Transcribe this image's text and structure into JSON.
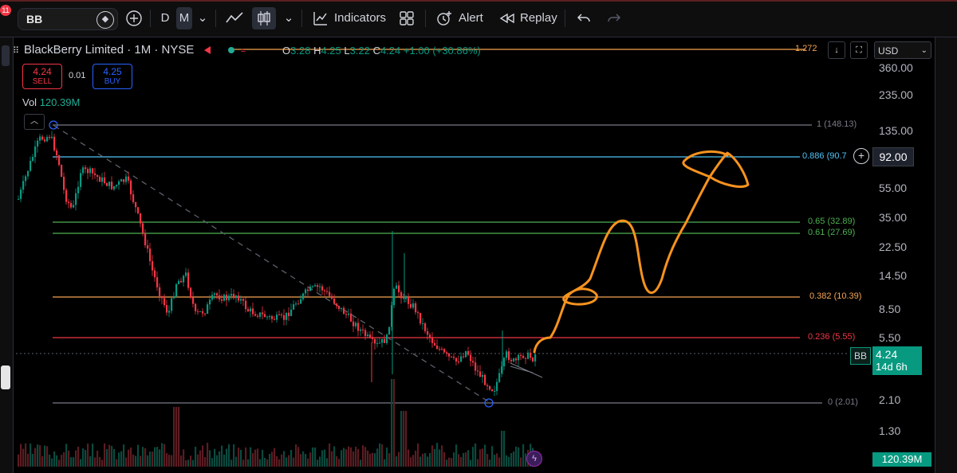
{
  "toolbar": {
    "notification_count": "11",
    "symbol": "BB",
    "interval_d": "D",
    "interval_m": "M",
    "indicators_label": "Indicators",
    "alert_label": "Alert",
    "replay_label": "Replay"
  },
  "legend": {
    "title": "BlackBerry Limited · 1M · NYSE",
    "open_label": "O",
    "open": "3.28",
    "high_label": "H",
    "high": "4.25",
    "low_label": "L",
    "low": "3.22",
    "close_label": "C",
    "close": "4.24",
    "change": "+1.00 (+30.86%)",
    "sell_price": "4.24",
    "sell_label": "SELL",
    "spread": "0.01",
    "buy_price": "4.25",
    "buy_label": "BUY",
    "volume_label": "Vol",
    "volume": "120.39M"
  },
  "price_axis": {
    "currency": "USD",
    "ticks": [
      "360.00",
      "235.00",
      "135.00",
      "55.00",
      "35.00",
      "22.50",
      "14.50",
      "8.50",
      "5.50",
      "2.10",
      "1.30"
    ],
    "crosshair_price": "92.00",
    "symbol_tag": "BB",
    "last_price": "4.24",
    "countdown": "14d 6h",
    "volume_tag": "120.39M"
  },
  "fib_levels": [
    {
      "label": "1.272",
      "color": "#f7a552"
    },
    {
      "label": "1 (148.13)",
      "color": "#787b86"
    },
    {
      "label": "0.886 (90.7",
      "color": "#4fc3f7"
    },
    {
      "label": "0.65 (32.89)",
      "color": "#4caf50"
    },
    {
      "label": "0.61 (27.69)",
      "color": "#4caf50"
    },
    {
      "label": "0.382 (10.39)",
      "color": "#f7a552"
    },
    {
      "label": "0.236 (5.55)",
      "color": "#f23645"
    },
    {
      "label": "0 (2.01)",
      "color": "#787b86"
    }
  ],
  "colors": {
    "up": "#089981",
    "down": "#f23645",
    "drawing": "#f7931e",
    "background": "#000000"
  },
  "icons": [
    "diamond-icon",
    "plus-circle-icon",
    "chevron-down-icon",
    "line-chart-icon",
    "candles-icon",
    "indicators-icon",
    "layout-grid-icon",
    "alert-clock-icon",
    "replay-icon",
    "undo-icon",
    "redo-icon",
    "arrow-down-icon",
    "fullscreen-icon",
    "lightning-icon"
  ]
}
